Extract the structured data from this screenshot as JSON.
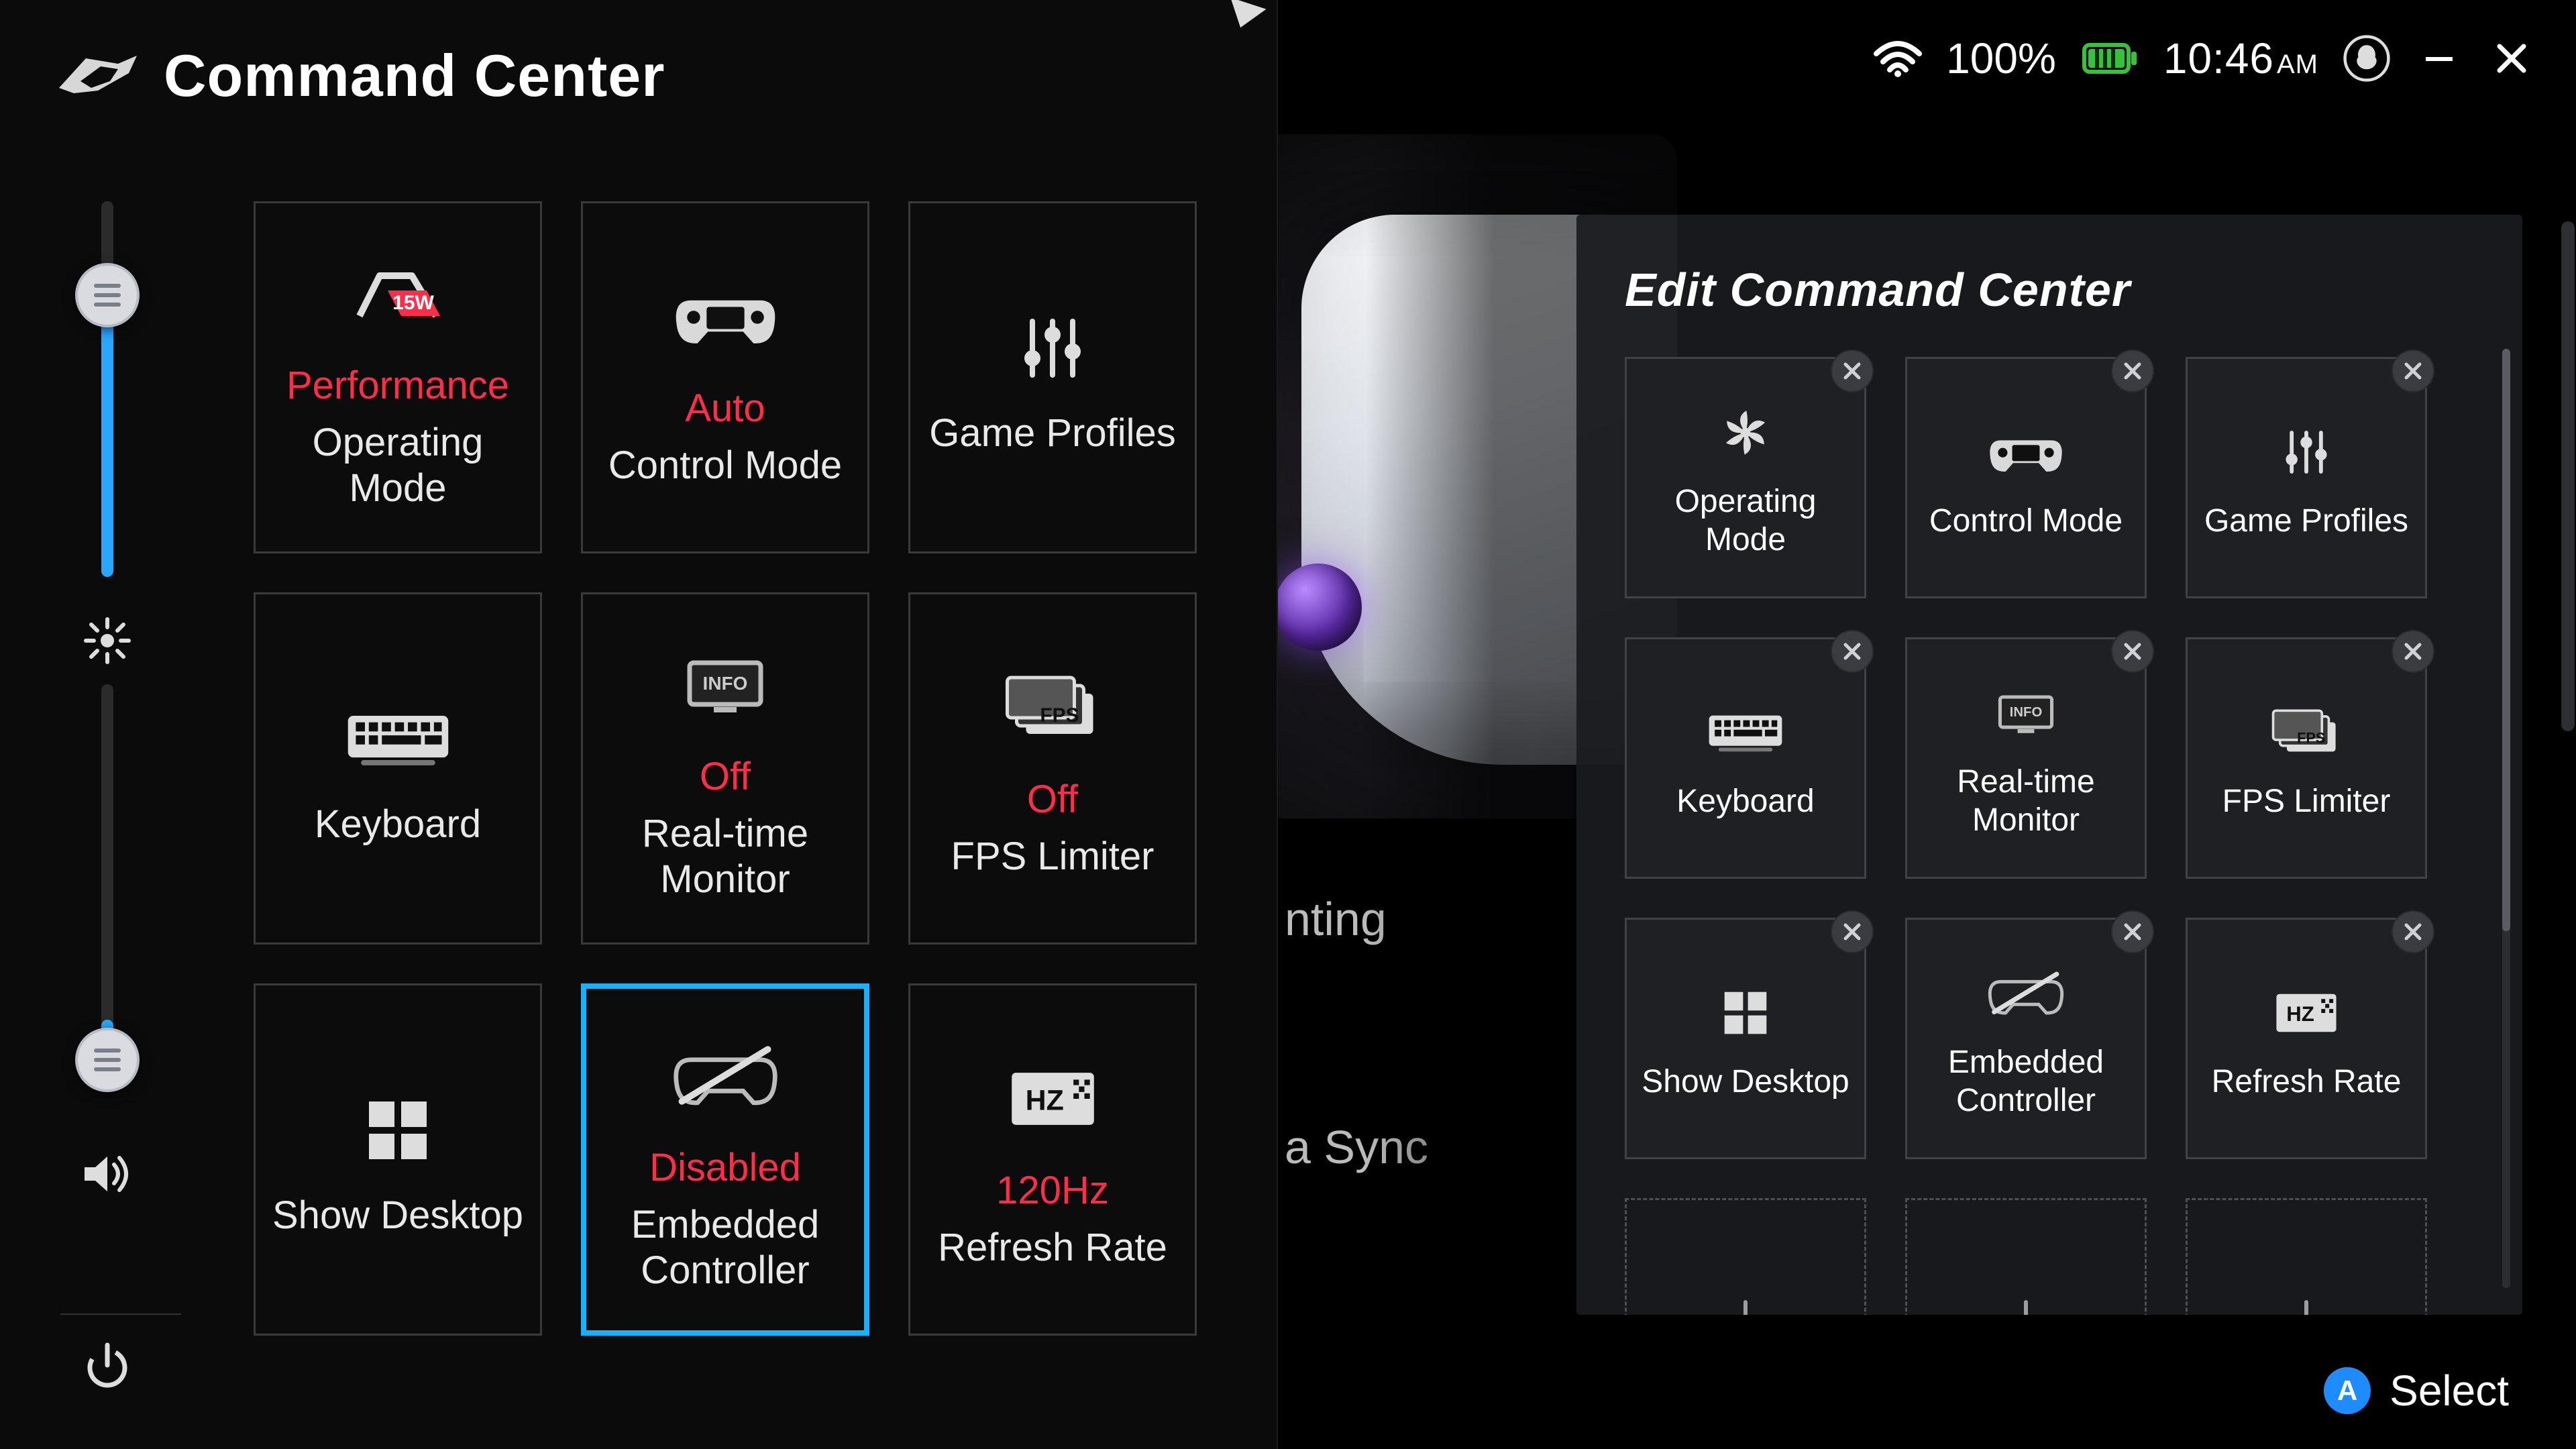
{
  "status": {
    "battery_pct": "100%",
    "time": "10:46",
    "time_suffix": "AM"
  },
  "overlay": {
    "title": "Command Center"
  },
  "tiles": [
    {
      "id": "operating-mode",
      "value": "Performance",
      "label": "Operating Mode",
      "icon": "power-mode",
      "selected": false
    },
    {
      "id": "control-mode",
      "value": "Auto",
      "label": "Control Mode",
      "icon": "gamepad",
      "selected": false
    },
    {
      "id": "game-profiles",
      "value": "",
      "label": "Game Profiles",
      "icon": "sliders",
      "selected": false
    },
    {
      "id": "keyboard",
      "value": "",
      "label": "Keyboard",
      "icon": "keyboard",
      "selected": false
    },
    {
      "id": "realtime-monitor",
      "value": "Off",
      "label": "Real-time Monitor",
      "icon": "info-mon",
      "selected": false
    },
    {
      "id": "fps-limiter",
      "value": "Off",
      "label": "FPS Limiter",
      "icon": "fps",
      "selected": false
    },
    {
      "id": "show-desktop",
      "value": "",
      "label": "Show Desktop",
      "icon": "desktop",
      "selected": false
    },
    {
      "id": "embedded-controller",
      "value": "Disabled",
      "label": "Embedded Controller",
      "icon": "embedded",
      "selected": true
    },
    {
      "id": "refresh-rate",
      "value": "120Hz",
      "label": "Refresh Rate",
      "icon": "hz",
      "selected": false
    }
  ],
  "edit_panel": {
    "title": "Edit Command Center",
    "items": [
      {
        "id": "operating-mode",
        "label": "Operating Mode",
        "icon": "fan"
      },
      {
        "id": "control-mode",
        "label": "Control Mode",
        "icon": "gamepad"
      },
      {
        "id": "game-profiles",
        "label": "Game Profiles",
        "icon": "sliders"
      },
      {
        "id": "keyboard",
        "label": "Keyboard",
        "icon": "keyboard"
      },
      {
        "id": "realtime-monitor",
        "label": "Real-time Monitor",
        "icon": "info-mon"
      },
      {
        "id": "fps-limiter",
        "label": "FPS Limiter",
        "icon": "fps"
      },
      {
        "id": "show-desktop",
        "label": "Show Desktop",
        "icon": "desktop"
      },
      {
        "id": "embedded-controller",
        "label": "Embedded Controller",
        "icon": "embedded"
      },
      {
        "id": "refresh-rate",
        "label": "Refresh Rate",
        "icon": "hz"
      }
    ]
  },
  "prompts": {
    "select_key": "A",
    "select_label": "Select"
  },
  "background_menu": {
    "item1_suffix": "nting",
    "item2_suffix": "a Sync"
  }
}
